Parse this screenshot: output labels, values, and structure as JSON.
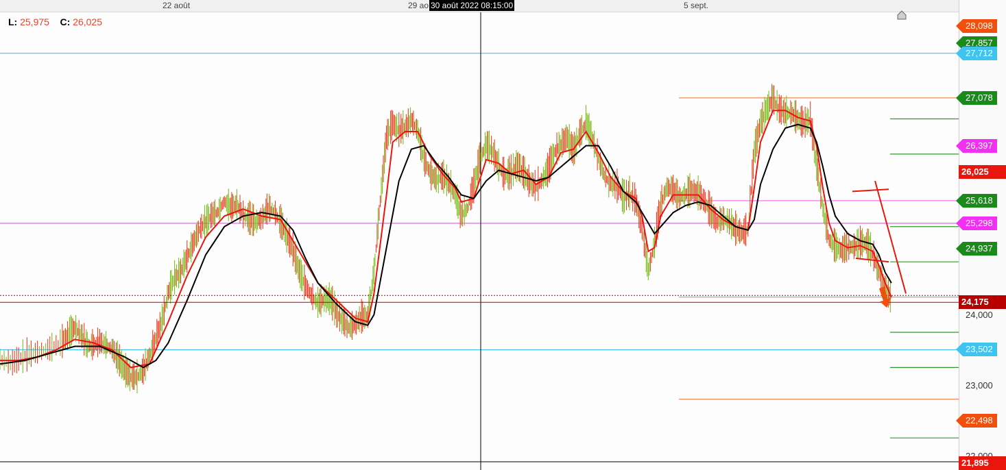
{
  "header": {
    "x_ticks": [
      "22 août",
      "29 ao",
      "5 sept."
    ],
    "crosshair_time": "30 août 2022 08:15:00"
  },
  "legend": {
    "low_label": "L:",
    "low_value": "25,975",
    "close_label": "C:",
    "close_value": "26,025"
  },
  "colors": {
    "up": "#7cbf1f",
    "down": "#e8432a",
    "ma_fast": "#e8160c",
    "ma_slow": "#000000",
    "cyan": "#3fc4f0",
    "magenta": "#f25ff2",
    "orange": "#f08a55",
    "green": "#2f9a2f",
    "price_line": "#b80000"
  },
  "chart_data": {
    "type": "line",
    "title": "",
    "x_labels": [
      "22 août",
      "29 ao",
      "5 sept."
    ],
    "y_tick_labels": [
      "24,000",
      "23,000",
      "22,000"
    ],
    "ylim": [
      21.85,
      28.3
    ],
    "price_series": [
      [
        0,
        23.35
      ],
      [
        2,
        23.3
      ],
      [
        4,
        23.4
      ],
      [
        6,
        23.45
      ],
      [
        8,
        23.5
      ],
      [
        10,
        23.6
      ],
      [
        11,
        23.7
      ],
      [
        12,
        23.8
      ],
      [
        13,
        23.7
      ],
      [
        14,
        23.55
      ],
      [
        15,
        23.55
      ],
      [
        16,
        23.6
      ],
      [
        17,
        23.55
      ],
      [
        18,
        23.5
      ],
      [
        19,
        23.35
      ],
      [
        20,
        23.2
      ],
      [
        21,
        23.1
      ],
      [
        22,
        23.1
      ],
      [
        23,
        23.2
      ],
      [
        24,
        23.4
      ],
      [
        25,
        23.65
      ],
      [
        26,
        23.9
      ],
      [
        27,
        24.3
      ],
      [
        28,
        24.5
      ],
      [
        29,
        24.6
      ],
      [
        30,
        24.8
      ],
      [
        31,
        25.0
      ],
      [
        32,
        25.2
      ],
      [
        33,
        25.3
      ],
      [
        34,
        25.4
      ],
      [
        35,
        25.45
      ],
      [
        36,
        25.6
      ],
      [
        37,
        25.5
      ],
      [
        38,
        25.55
      ],
      [
        39,
        25.4
      ],
      [
        40,
        25.35
      ],
      [
        41,
        25.3
      ],
      [
        42,
        25.35
      ],
      [
        43,
        25.5
      ],
      [
        44,
        25.45
      ],
      [
        45,
        25.3
      ],
      [
        46,
        25.1
      ],
      [
        47,
        24.9
      ],
      [
        48,
        24.6
      ],
      [
        49,
        24.4
      ],
      [
        50,
        24.25
      ],
      [
        51,
        24.15
      ],
      [
        52,
        24.2
      ],
      [
        53,
        24.2
      ],
      [
        54,
        24.0
      ],
      [
        55,
        23.9
      ],
      [
        56,
        23.8
      ],
      [
        57,
        23.85
      ],
      [
        58,
        23.95
      ],
      [
        59,
        23.95
      ],
      [
        60,
        24.6
      ],
      [
        61,
        25.6
      ],
      [
        62,
        26.5
      ],
      [
        63,
        26.7
      ],
      [
        64,
        26.6
      ],
      [
        65,
        26.65
      ],
      [
        66,
        26.75
      ],
      [
        67,
        26.6
      ],
      [
        68,
        26.2
      ],
      [
        69,
        26.0
      ],
      [
        70,
        25.9
      ],
      [
        71,
        25.95
      ],
      [
        72,
        25.85
      ],
      [
        73,
        25.7
      ],
      [
        74,
        25.4
      ],
      [
        75,
        25.5
      ],
      [
        76,
        25.8
      ],
      [
        77,
        26.2
      ],
      [
        78,
        26.4
      ],
      [
        79,
        26.3
      ],
      [
        80,
        26.1
      ],
      [
        81,
        25.95
      ],
      [
        82,
        26.0
      ],
      [
        83,
        26.1
      ],
      [
        84,
        26.0
      ],
      [
        85,
        25.85
      ],
      [
        86,
        25.8
      ],
      [
        87,
        25.9
      ],
      [
        88,
        26.05
      ],
      [
        89,
        26.3
      ],
      [
        90,
        26.4
      ],
      [
        91,
        26.5
      ],
      [
        92,
        26.3
      ],
      [
        93,
        26.55
      ],
      [
        94,
        26.7
      ],
      [
        95,
        26.5
      ],
      [
        96,
        26.2
      ],
      [
        97,
        25.95
      ],
      [
        98,
        25.85
      ],
      [
        99,
        25.8
      ],
      [
        100,
        25.65
      ],
      [
        101,
        25.7
      ],
      [
        102,
        25.6
      ],
      [
        103,
        25.2
      ],
      [
        104,
        24.6
      ],
      [
        105,
        25.0
      ],
      [
        106,
        25.55
      ],
      [
        107,
        25.8
      ],
      [
        108,
        25.75
      ],
      [
        109,
        25.65
      ],
      [
        110,
        25.7
      ],
      [
        111,
        25.75
      ],
      [
        112,
        25.7
      ],
      [
        113,
        25.6
      ],
      [
        114,
        25.45
      ],
      [
        115,
        25.3
      ],
      [
        116,
        25.35
      ],
      [
        117,
        25.3
      ],
      [
        118,
        25.2
      ],
      [
        119,
        25.15
      ],
      [
        120,
        25.2
      ],
      [
        121,
        26.3
      ],
      [
        122,
        26.7
      ],
      [
        123,
        26.9
      ],
      [
        124,
        27.05
      ],
      [
        125,
        26.9
      ],
      [
        126,
        26.85
      ],
      [
        127,
        26.85
      ],
      [
        128,
        26.75
      ],
      [
        129,
        26.7
      ],
      [
        130,
        26.75
      ],
      [
        131,
        26.1
      ],
      [
        132,
        25.5
      ],
      [
        133,
        25.05
      ],
      [
        134,
        24.95
      ],
      [
        135,
        24.9
      ],
      [
        136,
        24.95
      ],
      [
        137,
        24.95
      ],
      [
        138,
        25.0
      ],
      [
        139,
        25.0
      ],
      [
        140,
        24.85
      ],
      [
        141,
        24.6
      ],
      [
        142,
        24.35
      ],
      [
        143,
        24.2
      ]
    ],
    "ma_fast": [
      [
        0,
        23.35
      ],
      [
        3,
        23.35
      ],
      [
        6,
        23.4
      ],
      [
        9,
        23.5
      ],
      [
        12,
        23.65
      ],
      [
        15,
        23.6
      ],
      [
        18,
        23.5
      ],
      [
        21,
        23.25
      ],
      [
        24,
        23.3
      ],
      [
        27,
        23.9
      ],
      [
        30,
        24.55
      ],
      [
        33,
        25.1
      ],
      [
        36,
        25.4
      ],
      [
        39,
        25.5
      ],
      [
        42,
        25.4
      ],
      [
        45,
        25.35
      ],
      [
        48,
        24.9
      ],
      [
        51,
        24.45
      ],
      [
        54,
        24.2
      ],
      [
        57,
        23.95
      ],
      [
        59,
        23.9
      ],
      [
        60,
        24.3
      ],
      [
        62,
        25.7
      ],
      [
        63,
        26.45
      ],
      [
        65,
        26.6
      ],
      [
        67,
        26.6
      ],
      [
        69,
        26.25
      ],
      [
        71,
        26.0
      ],
      [
        73,
        25.8
      ],
      [
        74,
        25.6
      ],
      [
        76,
        25.65
      ],
      [
        78,
        26.2
      ],
      [
        80,
        26.15
      ],
      [
        82,
        26.0
      ],
      [
        84,
        26.05
      ],
      [
        86,
        25.85
      ],
      [
        88,
        25.95
      ],
      [
        90,
        26.3
      ],
      [
        92,
        26.35
      ],
      [
        94,
        26.6
      ],
      [
        96,
        26.3
      ],
      [
        98,
        25.95
      ],
      [
        100,
        25.75
      ],
      [
        102,
        25.65
      ],
      [
        103,
        25.4
      ],
      [
        104,
        24.9
      ],
      [
        105,
        24.95
      ],
      [
        106,
        25.4
      ],
      [
        108,
        25.7
      ],
      [
        110,
        25.7
      ],
      [
        112,
        25.7
      ],
      [
        114,
        25.5
      ],
      [
        116,
        25.35
      ],
      [
        118,
        25.25
      ],
      [
        120,
        25.2
      ],
      [
        121,
        25.8
      ],
      [
        122,
        26.45
      ],
      [
        124,
        26.9
      ],
      [
        126,
        26.9
      ],
      [
        128,
        26.8
      ],
      [
        130,
        26.75
      ],
      [
        131,
        26.4
      ],
      [
        132,
        25.8
      ],
      [
        133,
        25.3
      ],
      [
        134,
        25.05
      ],
      [
        136,
        24.95
      ],
      [
        138,
        24.98
      ],
      [
        140,
        24.9
      ],
      [
        141,
        24.7
      ],
      [
        142,
        24.45
      ],
      [
        143,
        24.25
      ]
    ],
    "ma_slow": [
      [
        0,
        23.3
      ],
      [
        4,
        23.35
      ],
      [
        8,
        23.45
      ],
      [
        12,
        23.55
      ],
      [
        16,
        23.55
      ],
      [
        20,
        23.4
      ],
      [
        23,
        23.25
      ],
      [
        25,
        23.35
      ],
      [
        27,
        23.6
      ],
      [
        30,
        24.2
      ],
      [
        33,
        24.85
      ],
      [
        36,
        25.25
      ],
      [
        39,
        25.4
      ],
      [
        42,
        25.45
      ],
      [
        45,
        25.4
      ],
      [
        47,
        25.2
      ],
      [
        49,
        24.8
      ],
      [
        51,
        24.45
      ],
      [
        54,
        24.15
      ],
      [
        57,
        23.9
      ],
      [
        59,
        23.85
      ],
      [
        60,
        24.0
      ],
      [
        62,
        24.95
      ],
      [
        64,
        25.9
      ],
      [
        66,
        26.35
      ],
      [
        68,
        26.4
      ],
      [
        70,
        26.15
      ],
      [
        72,
        25.95
      ],
      [
        74,
        25.7
      ],
      [
        76,
        25.65
      ],
      [
        78,
        25.9
      ],
      [
        80,
        26.05
      ],
      [
        82,
        26.0
      ],
      [
        84,
        25.95
      ],
      [
        86,
        25.9
      ],
      [
        88,
        25.95
      ],
      [
        90,
        26.1
      ],
      [
        92,
        26.25
      ],
      [
        94,
        26.4
      ],
      [
        96,
        26.4
      ],
      [
        98,
        26.1
      ],
      [
        100,
        25.75
      ],
      [
        102,
        25.6
      ],
      [
        104,
        25.3
      ],
      [
        105,
        25.15
      ],
      [
        106,
        25.25
      ],
      [
        108,
        25.45
      ],
      [
        110,
        25.55
      ],
      [
        112,
        25.6
      ],
      [
        114,
        25.55
      ],
      [
        116,
        25.4
      ],
      [
        118,
        25.25
      ],
      [
        120,
        25.2
      ],
      [
        121,
        25.35
      ],
      [
        122,
        25.85
      ],
      [
        124,
        26.35
      ],
      [
        126,
        26.65
      ],
      [
        128,
        26.7
      ],
      [
        130,
        26.65
      ],
      [
        131,
        26.45
      ],
      [
        132,
        26.1
      ],
      [
        133,
        25.7
      ],
      [
        134,
        25.4
      ],
      [
        136,
        25.15
      ],
      [
        138,
        25.05
      ],
      [
        140,
        25.0
      ],
      [
        141,
        24.85
      ],
      [
        142,
        24.6
      ],
      [
        143,
        24.45
      ]
    ],
    "horizontal_levels": [
      {
        "value": 27.712,
        "color": "cyan",
        "scope": "full"
      },
      {
        "value": 25.298,
        "color": "magenta",
        "scope": "full"
      },
      {
        "value": 23.502,
        "color": "cyan",
        "scope": "full"
      },
      {
        "value": 27.078,
        "color": "orange",
        "scope": "right"
      },
      {
        "value": 24.25,
        "color": "orange",
        "scope": "right"
      },
      {
        "value": 22.8,
        "color": "orange",
        "scope": "right"
      },
      {
        "value": 25.618,
        "color": "magenta",
        "scope": "right"
      },
      {
        "value": 26.78,
        "color": "green",
        "scope": "far"
      },
      {
        "value": 26.28,
        "color": "green",
        "scope": "far"
      },
      {
        "value": 25.25,
        "color": "green",
        "scope": "far"
      },
      {
        "value": 24.75,
        "color": "green",
        "scope": "far"
      },
      {
        "value": 23.75,
        "color": "green",
        "scope": "far"
      },
      {
        "value": 23.25,
        "color": "green",
        "scope": "far"
      },
      {
        "value": 22.25,
        "color": "green",
        "scope": "far"
      }
    ],
    "last_price": 24.175
  },
  "axis_tags": [
    {
      "text": "28,098",
      "value": 28.098,
      "bg": "#f0500e",
      "arrow": true
    },
    {
      "text": "27,857",
      "value": 27.857,
      "bg": "#1a8a1a",
      "arrow": true
    },
    {
      "text": "27,712",
      "value": 27.712,
      "bg": "#3fc4f0",
      "arrow": true
    },
    {
      "text": "27,078",
      "value": 27.078,
      "bg": "#1a8a1a",
      "arrow": true
    },
    {
      "text": "26,397",
      "value": 26.397,
      "bg": "#f230f2",
      "arrow": true
    },
    {
      "text": "26,025",
      "value": 26.025,
      "bg": "#e8160c",
      "arrow": false
    },
    {
      "text": "25,618",
      "value": 25.618,
      "bg": "#1a8a1a",
      "arrow": true
    },
    {
      "text": "25,298",
      "value": 25.298,
      "bg": "#f230f2",
      "arrow": true
    },
    {
      "text": "24,937",
      "value": 24.937,
      "bg": "#1a8a1a",
      "arrow": true
    },
    {
      "text": "24,175",
      "value": 24.175,
      "bg": "#b80000",
      "arrow": false
    },
    {
      "text": "23,502",
      "value": 23.502,
      "bg": "#3fc4f0",
      "arrow": true
    },
    {
      "text": "22,498",
      "value": 22.498,
      "bg": "#f0500e",
      "arrow": true
    },
    {
      "text": "21,895",
      "value": 21.895,
      "bg": "#e8160c",
      "arrow": false
    }
  ]
}
